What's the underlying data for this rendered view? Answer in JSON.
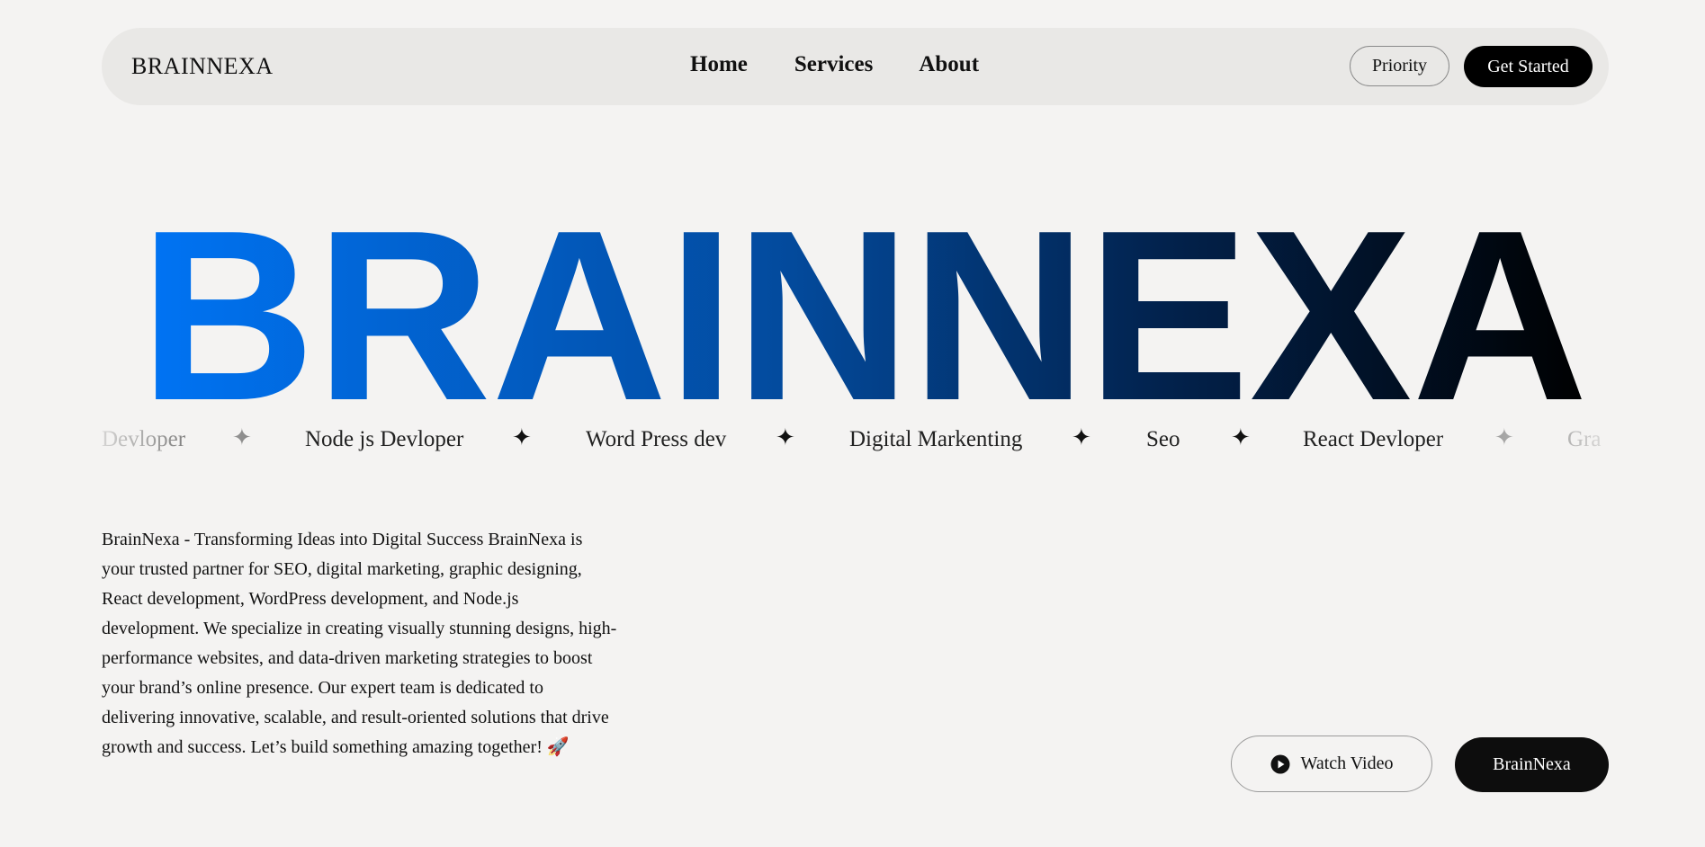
{
  "navbar": {
    "brand": "BRAINNEXA",
    "links": [
      "Home",
      "Services",
      "About"
    ],
    "priority_label": "Priority",
    "get_started_label": "Get Started"
  },
  "hero": {
    "word": "BRAINNEXA",
    "gradient_start": "#0074f5",
    "gradient_end": "#000000"
  },
  "marquee": {
    "items": [
      "Devloper",
      "Node js Devloper",
      "Word Press dev",
      "Digital Markenting",
      "Seo",
      "React Devloper",
      "Gra"
    ],
    "separator_icon": "sparkle-star-icon"
  },
  "description": {
    "text": "BrainNexa - Transforming Ideas into Digital Success BrainNexa is your trusted partner for SEO, digital marketing, graphic designing, React development, WordPress development, and Node.js development. We specialize in creating visually stunning designs, high-performance websites, and data-driven marketing strategies to boost your brand’s online presence. Our expert team is dedicated to delivering innovative, scalable, and result-oriented solutions that drive growth and success. Let’s build something amazing together! 🚀"
  },
  "actions": {
    "watch_video_label": "Watch Video",
    "play_icon": "play-circle-icon",
    "brainnexa_label": "BrainNexa"
  }
}
